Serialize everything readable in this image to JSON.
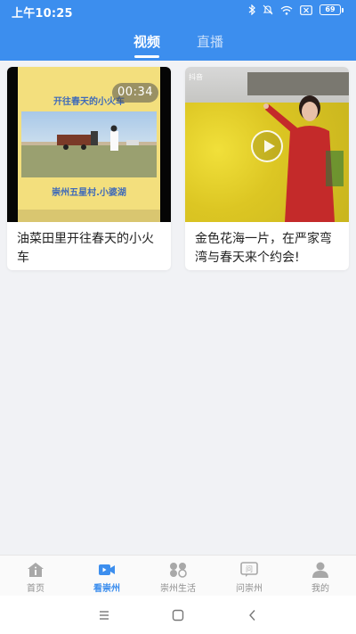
{
  "status_bar": {
    "time": "上午10:25",
    "battery": "69"
  },
  "tabs": [
    {
      "label": "视频",
      "active": true
    },
    {
      "label": "直播",
      "active": false
    }
  ],
  "videos": [
    {
      "title": "油菜田里开往春天的小火车",
      "duration": "00:34",
      "thumb_headline": "开往春天的小火车",
      "thumb_caption": "崇州五星村.小婆湖"
    },
    {
      "title": "金色花海一片，在严家弯湾与春天来个约会!",
      "thumb_logo": "抖音"
    }
  ],
  "bottom_nav": [
    {
      "label": "首页",
      "icon": "home-icon",
      "active": false
    },
    {
      "label": "看崇州",
      "icon": "video-camera-icon",
      "active": true
    },
    {
      "label": "崇州生活",
      "icon": "grid-icon",
      "active": false
    },
    {
      "label": "问崇州",
      "icon": "question-icon",
      "active": false
    },
    {
      "label": "我的",
      "icon": "user-icon",
      "active": false
    }
  ],
  "colors": {
    "primary": "#3c8eee",
    "page_bg": "#f1f2f5",
    "inactive": "#8f8f8f"
  }
}
